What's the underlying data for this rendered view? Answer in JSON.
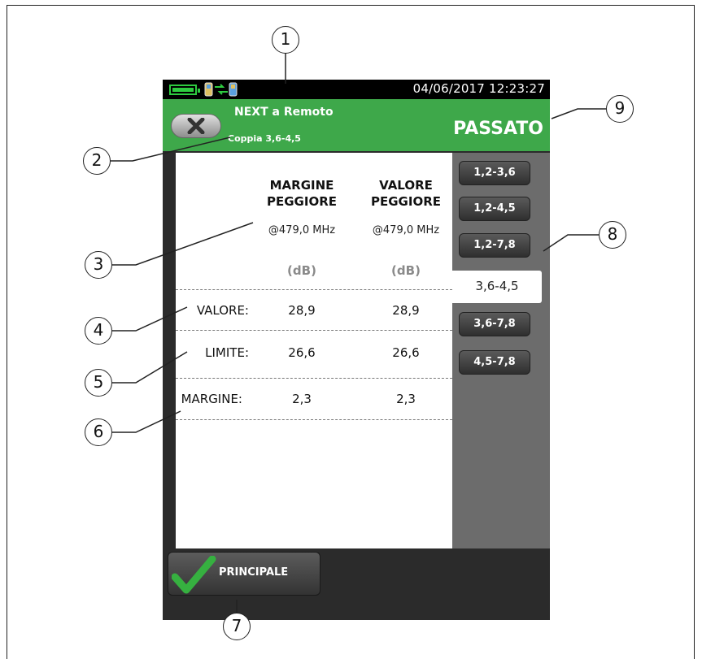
{
  "statusbar": {
    "datetime": "04/06/2017 12:23:27",
    "battery_icon": "battery-full-icon",
    "link_icon": "remote-link-icon"
  },
  "header": {
    "test_title": "NEXT a Remoto",
    "pair": "Coppia 3,6-4,5",
    "result": "PASSATO",
    "back_icon": "close-x-icon",
    "status_color": "#3ea84a"
  },
  "table": {
    "col1_line1": "MARGINE",
    "col1_line2": "PEGGIORE",
    "col1_freq": "@479,0 MHz",
    "col1_unit": "(dB)",
    "col2_line1": "VALORE",
    "col2_line2": "PEGGIORE",
    "col2_freq": "@479,0 MHz",
    "col2_unit": "(dB)",
    "rows": [
      {
        "label": "VALORE:",
        "v1": "28,9",
        "v2": "28,9"
      },
      {
        "label": "LIMITE:",
        "v1": "26,6",
        "v2": "26,6"
      },
      {
        "label": "MARGINE:",
        "v1": "2,3",
        "v2": "2,3"
      }
    ]
  },
  "pairs": {
    "items": [
      "1,2-3,6",
      "1,2-4,5",
      "1,2-7,8",
      "3,6-4,5",
      "3,6-7,8",
      "4,5-7,8"
    ],
    "selected": "3,6-4,5"
  },
  "footer": {
    "main_label": "PRINCIPALE",
    "main_icon": "checkmark-icon"
  },
  "callouts": [
    "1",
    "2",
    "3",
    "4",
    "5",
    "6",
    "7",
    "8",
    "9"
  ]
}
